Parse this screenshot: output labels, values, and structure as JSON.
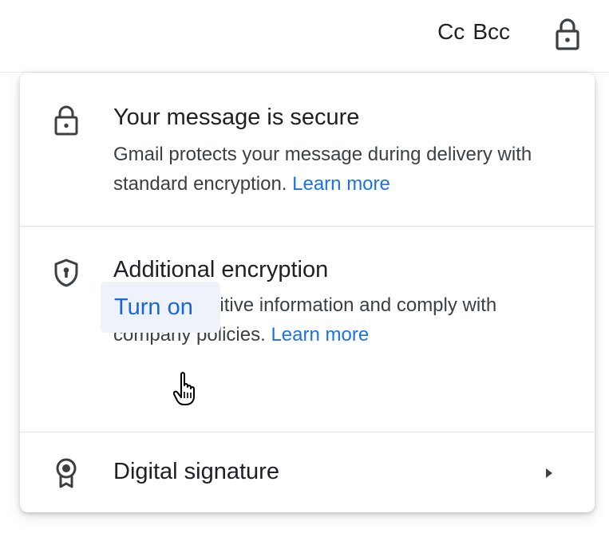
{
  "header": {
    "cc_label": "Cc",
    "bcc_label": "Bcc",
    "lock_icon": "lock-icon"
  },
  "popover": {
    "secure": {
      "icon": "lock-icon",
      "title": "Your message is secure",
      "description": "Gmail protects your message during delivery with standard encryption.",
      "learn_more": "Learn more"
    },
    "additional": {
      "icon": "shield-icon",
      "title": "Additional encryption",
      "description": "Protect sensitive information and comply with company policies.",
      "learn_more": "Learn more",
      "button": "Turn on"
    },
    "signature": {
      "icon": "award-badge-icon",
      "title": "Digital signature",
      "chevron_icon": "chevron-right-icon"
    }
  },
  "colors": {
    "link": "#1a73e8",
    "button_bg": "#eef2fb",
    "text": "#202124",
    "secondary_text": "#3c4043"
  }
}
